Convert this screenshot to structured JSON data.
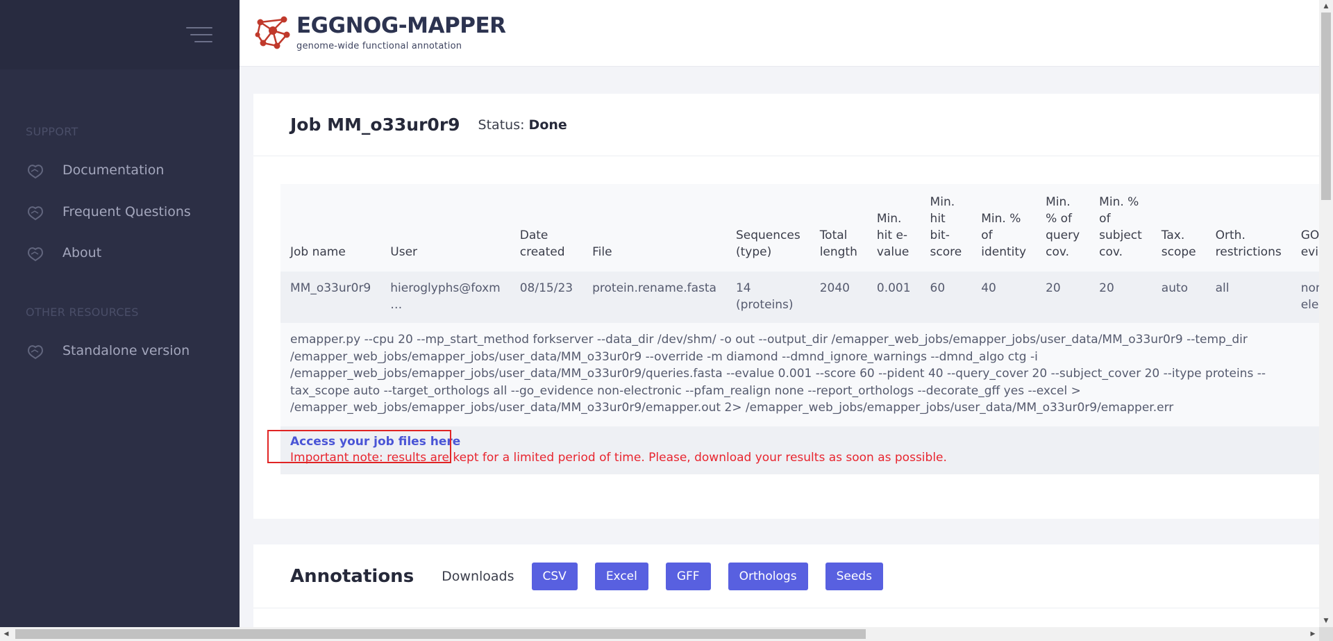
{
  "sidebar": {
    "support_heading": "SUPPORT",
    "support_items": [
      {
        "label": "Documentation",
        "icon": "heart-hand-icon"
      },
      {
        "label": "Frequent Questions",
        "icon": "heart-hand-icon"
      },
      {
        "label": "About",
        "icon": "heart-hand-icon"
      }
    ],
    "resources_heading": "OTHER RESOURCES",
    "resources_items": [
      {
        "label": "Standalone version",
        "icon": "heart-hand-icon"
      }
    ]
  },
  "header": {
    "logo_title": "EGGNOG-MAPPER",
    "logo_subtitle": "genome-wide functional annotation"
  },
  "job": {
    "title": "Job MM_o33ur0r9",
    "status_label": "Status:",
    "status_value": "Done",
    "columns": [
      "Job name",
      "User",
      "Date created",
      "File",
      "Sequences (type)",
      "Total length",
      "Min. hit e-value",
      "Min. hit bit-score",
      "Min. % of identity",
      "Min. % of query cov.",
      "Min. % of subject cov.",
      "Tax. scope",
      "Orth. restrictions",
      "GO evidence"
    ],
    "row": [
      "MM_o33ur0r9",
      "hieroglyphs@foxm …",
      "08/15/23",
      "protein.rename.fasta",
      "14 (proteins)",
      "2040",
      "0.001",
      "60",
      "40",
      "20",
      "20",
      "auto",
      "all",
      "non-electronic"
    ],
    "command": "emapper.py --cpu 20 --mp_start_method forkserver --data_dir /dev/shm/ -o out --output_dir /emapper_web_jobs/emapper_jobs/user_data/MM_o33ur0r9 --temp_dir /emapper_web_jobs/emapper_jobs/user_data/MM_o33ur0r9 --override -m diamond --dmnd_ignore_warnings --dmnd_algo ctg -i /emapper_web_jobs/emapper_jobs/user_data/MM_o33ur0r9/queries.fasta --evalue 0.001 --score 60 --pident 40 --query_cover 20 --subject_cover 20 --itype proteins --tax_scope auto --target_orthologs all --go_evidence non-electronic --pfam_realign none --report_orthologs --decorate_gff yes --excel > /emapper_web_jobs/emapper_jobs/user_data/MM_o33ur0r9/emapper.out 2> /emapper_web_jobs/emapper_jobs/user_data/MM_o33ur0r9/emapper.err",
    "access_link": "Access your job files here",
    "note": "Important note: results are kept for a limited period of time. Please, download your results as soon as possible."
  },
  "annotations": {
    "title": "Annotations",
    "downloads_label": "Downloads",
    "buttons": [
      "CSV",
      "Excel",
      "GFF",
      "Orthologs",
      "Seeds"
    ]
  },
  "colors": {
    "sidebar_bg": "#2c2f45",
    "accent": "#5860e0",
    "link": "#4a55d6",
    "warning": "#e8252f"
  }
}
